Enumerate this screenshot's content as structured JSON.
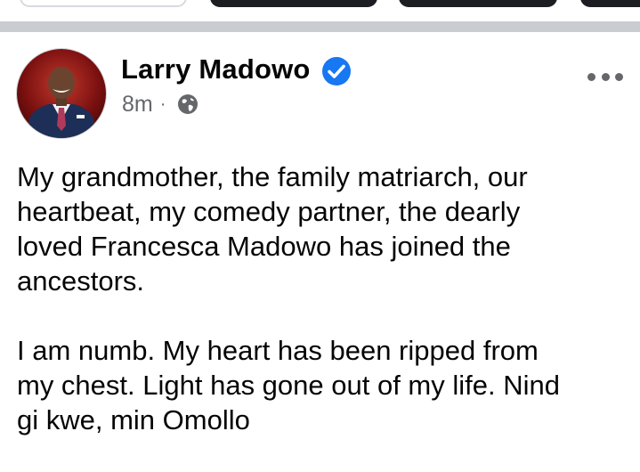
{
  "post": {
    "author": "Larry Madowo",
    "timestamp": "8m",
    "separator": "·",
    "audience_icon": "globe-icon",
    "verified_icon": "verified-badge-icon",
    "more_icon": "more-options-icon",
    "paragraphs": [
      {
        "lines": [
          "My grandmother, the family matriarch, our",
          "heartbeat, my comedy partner, the dearly",
          "loved Francesca Madowo has joined the",
          "ancestors."
        ]
      },
      {
        "lines": [
          "I am numb. My heart has been ripped from",
          "my chest. Light has gone out of my life. Nind",
          "gi kwe, min Omollo"
        ]
      }
    ]
  },
  "colors": {
    "verified_blue": "#1877f2",
    "meta_gray": "#65676b",
    "text": "#050505",
    "divider": "#c9ccd1"
  }
}
